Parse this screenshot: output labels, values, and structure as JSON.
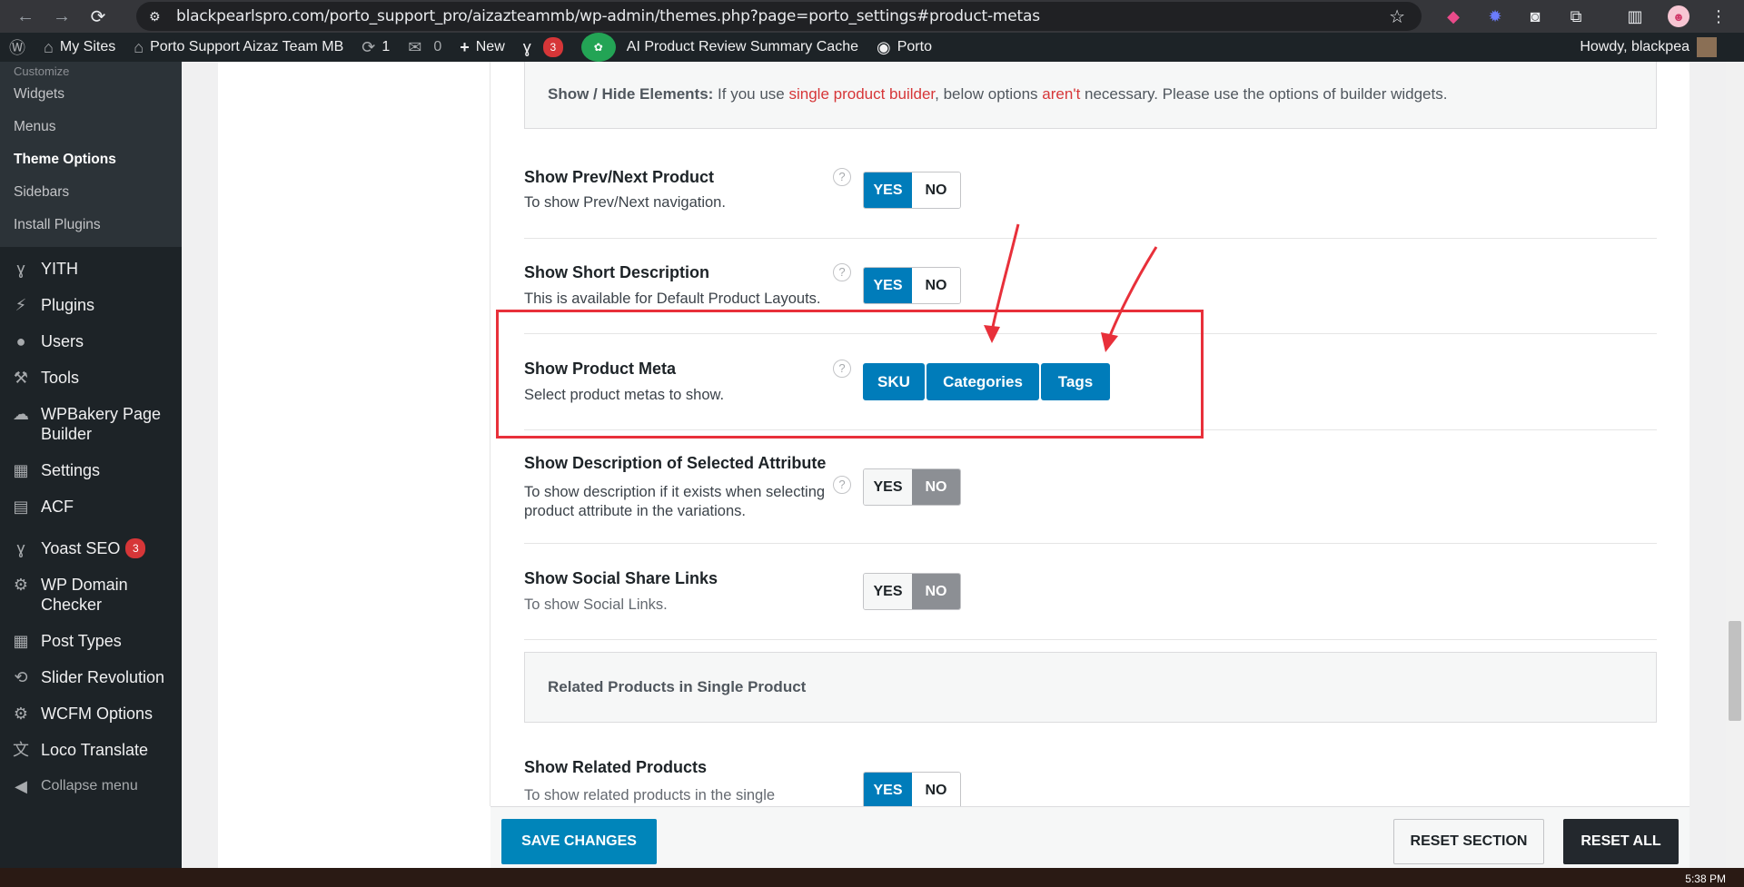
{
  "browser": {
    "url": "blackpearlspro.com/porto_support_pro/aizazteammb/wp-admin/themes.php?page=porto_settings#product-metas"
  },
  "adminbar": {
    "my_sites": "My Sites",
    "site_name": "Porto Support Aizaz Team MB",
    "updates": "1",
    "comments": "0",
    "new": "New",
    "yoast_badge": "3",
    "ai_cache": "AI Product Review Summary Cache",
    "porto": "Porto",
    "howdy": "Howdy, blackpea"
  },
  "sidebar": {
    "submenu_cut": "Customize",
    "submenu": [
      {
        "label": "Widgets"
      },
      {
        "label": "Menus"
      },
      {
        "label": "Theme Options"
      },
      {
        "label": "Sidebars"
      },
      {
        "label": "Install Plugins"
      }
    ],
    "menu": [
      {
        "label": "YITH"
      },
      {
        "label": "Plugins"
      },
      {
        "label": "Users"
      },
      {
        "label": "Tools"
      },
      {
        "label": "WPBakery Page Builder"
      },
      {
        "label": "Settings"
      },
      {
        "label": "ACF"
      },
      {
        "label": "Yoast SEO",
        "badge": "3"
      },
      {
        "label": "WP Domain Checker"
      },
      {
        "label": "Post Types"
      },
      {
        "label": "Slider Revolution"
      },
      {
        "label": "WCFM Options"
      },
      {
        "label": "Loco Translate"
      },
      {
        "label": "Collapse menu"
      }
    ]
  },
  "info": {
    "label": "Show / Hide Elements:",
    "text1": " If you use ",
    "link1": "single product builder",
    "text2": ", below options ",
    "link2": "aren't",
    "text3": " necessary. Please use the options of builder widgets."
  },
  "options": [
    {
      "title": "Show Prev/Next Product",
      "desc": "To show Prev/Next navigation.",
      "yes": "YES",
      "no": "NO"
    },
    {
      "title": "Show Short Description",
      "desc": "This is available for Default Product Layouts.",
      "yes": "YES",
      "no": "NO"
    },
    {
      "title": "Show Product Meta",
      "desc": "Select product metas to show.",
      "metas": [
        "SKU",
        "Categories",
        "Tags"
      ]
    },
    {
      "title": "Show Description of Selected Attribute",
      "desc": "To show description if it exists when selecting product attribute in the variations.",
      "yes": "YES",
      "no": "NO"
    },
    {
      "title": "Show Social Share Links",
      "desc": "To show Social Links.",
      "yes": "YES",
      "no": "NO"
    },
    {
      "title": "Show Related Products",
      "desc": "To show related products in the single",
      "yes": "YES",
      "no": "NO"
    }
  ],
  "section": {
    "title": "Related Products in Single Product"
  },
  "footer": {
    "save": "SAVE CHANGES",
    "reset_section": "RESET SECTION",
    "reset_all": "RESET ALL"
  },
  "taskbar": {
    "clock": "5:38 PM"
  },
  "colors": {
    "accent": "#007cba",
    "annotation": "#e8303a",
    "admin_dark": "#1d2327"
  }
}
